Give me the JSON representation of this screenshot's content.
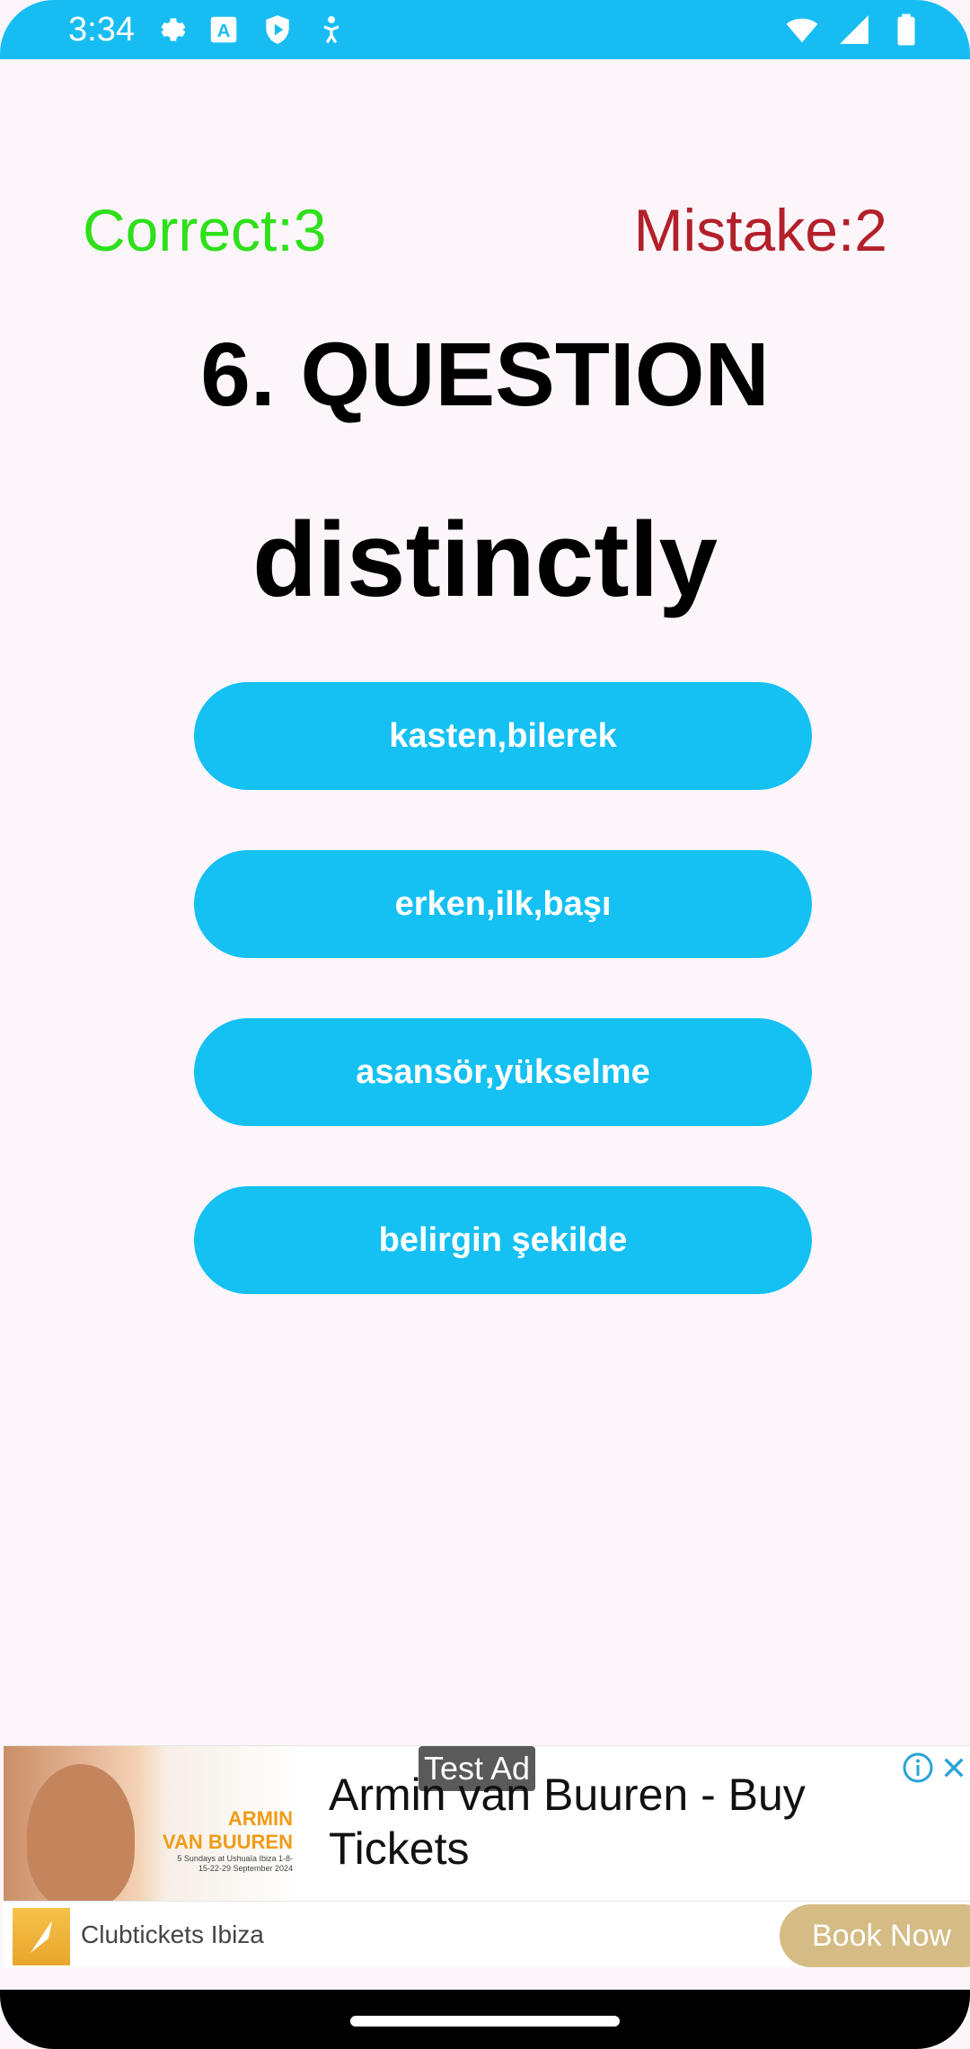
{
  "status_bar": {
    "time": "3:34",
    "left_icons": [
      "settings-icon",
      "text-a-icon",
      "play-protect-icon",
      "accessibility-icon"
    ],
    "right_icons": [
      "wifi-icon",
      "signal-icon",
      "battery-icon"
    ],
    "color": "#17BDF2"
  },
  "score": {
    "correct": "Correct:3",
    "mistake": "Mistake:2",
    "correct_color": "#2EE01A",
    "mistake_color": "#B3202A"
  },
  "question": {
    "number": "6. QUESTION",
    "word": "distinctly"
  },
  "answers": [
    "kasten,bilerek",
    "erken,ilk,başı",
    "asansör,yükselme",
    "belirgin şekilde"
  ],
  "ad": {
    "test_label": "Test Ad",
    "headline": "Armin van Buuren - Buy Tickets",
    "advertiser": "Clubtickets Ibiza",
    "cta": "Book Now",
    "image_title_1": "ARMIN",
    "image_title_2": "VAN BUUREN",
    "image_sub": "5 Sundays at Ushuaïa Ibiza 1-8-15-22-29 September 2024",
    "cta_color": "#D4BC84"
  }
}
